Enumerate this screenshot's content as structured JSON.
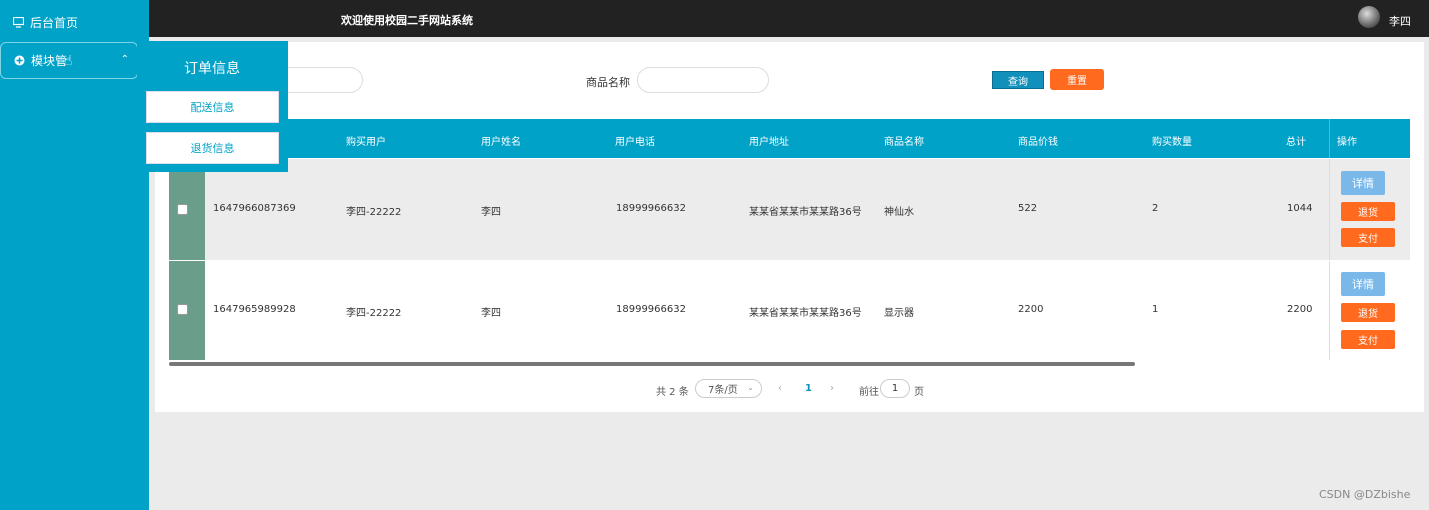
{
  "sidebar": {
    "home_label": "后台首页",
    "module_label": "模块管",
    "submenu": {
      "title": "订单信息",
      "items": [
        "配送信息",
        "退货信息"
      ]
    }
  },
  "header": {
    "title": "欢迎使用校园二手网站系统",
    "username": "李四"
  },
  "search": {
    "product_label": "商品名称",
    "query_button": "查询",
    "reset_button": "重置"
  },
  "table": {
    "headers": [
      "购买用户",
      "用户姓名",
      "用户电话",
      "用户地址",
      "商品名称",
      "商品价钱",
      "购买数量",
      "总计",
      "操作"
    ],
    "rows": [
      {
        "order_no": "1647966087369",
        "buyer": "李四-22222",
        "name": "李四",
        "phone": "18999966632",
        "address": "某某省某某市某某路36号",
        "product": "神仙水",
        "price": "522",
        "quantity": "2",
        "total": "1044"
      },
      {
        "order_no": "1647965989928",
        "buyer": "李四-22222",
        "name": "李四",
        "phone": "18999966632",
        "address": "某某省某某市某某路36号",
        "product": "显示器",
        "price": "2200",
        "quantity": "1",
        "total": "2200"
      }
    ],
    "actions": {
      "detail": "详情",
      "return": "退货",
      "pay": "支付"
    }
  },
  "pagination": {
    "total_text": "共 2 条",
    "page_size": "7条/页",
    "prev": "‹",
    "current_page": "1",
    "next": "›",
    "goto_label": "前往",
    "goto_value": "1",
    "page_suffix": "页"
  },
  "watermark": "CSDN @DZbishe"
}
